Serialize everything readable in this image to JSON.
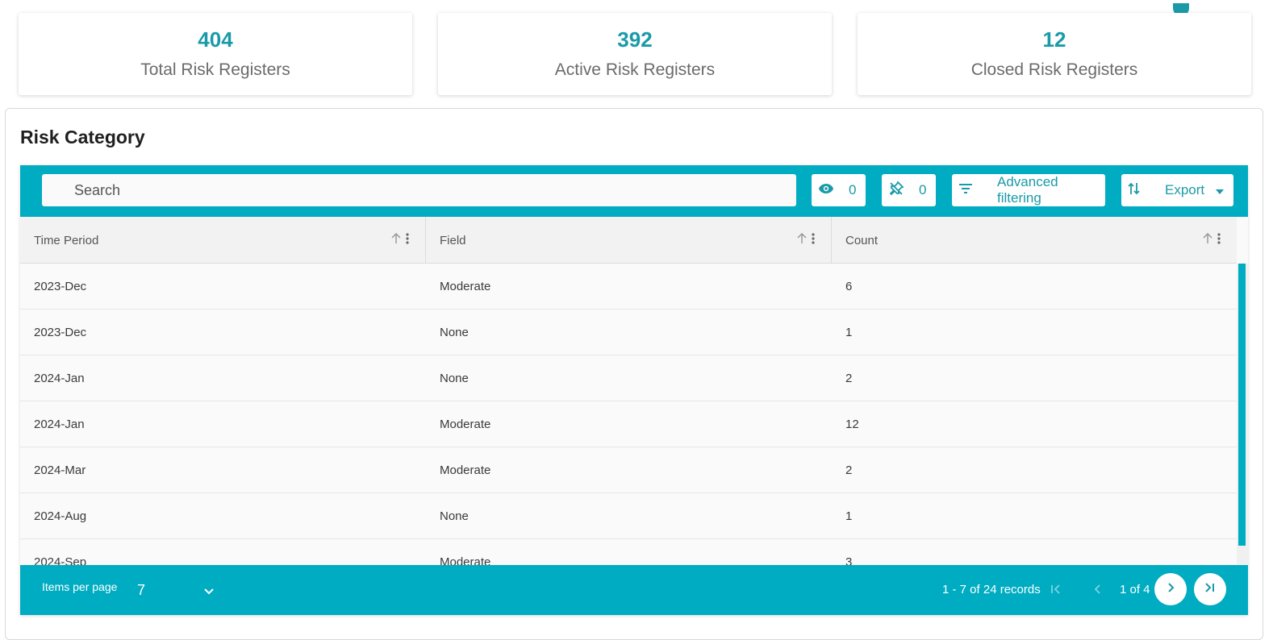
{
  "stats": [
    {
      "value": "404",
      "label": "Total Risk Registers"
    },
    {
      "value": "392",
      "label": "Active Risk Registers"
    },
    {
      "value": "12",
      "label": "Closed Risk Registers"
    }
  ],
  "panel": {
    "title": "Risk Category"
  },
  "toolbar": {
    "search_placeholder": "Search",
    "hidden_count": "0",
    "pinned_count": "0",
    "filter_label": "Advanced filtering",
    "export_label": "Export"
  },
  "table": {
    "columns": [
      "Time Period",
      "Field",
      "Count"
    ],
    "rows": [
      [
        "2023-Dec",
        "Moderate",
        "6"
      ],
      [
        "2023-Dec",
        "None",
        "1"
      ],
      [
        "2024-Jan",
        "None",
        "2"
      ],
      [
        "2024-Jan",
        "Moderate",
        "12"
      ],
      [
        "2024-Mar",
        "Moderate",
        "2"
      ],
      [
        "2024-Aug",
        "None",
        "1"
      ],
      [
        "2024-Sep",
        "Moderate",
        "3"
      ]
    ]
  },
  "pager": {
    "items_per_page_label": "Items per page",
    "items_per_page_value": "7",
    "range_text": "1 - 7 of 24 records",
    "page_text": "1 of 4"
  },
  "colors": {
    "accent": "#00acc1",
    "stat_value": "#1a9aa8"
  },
  "icons": [
    "eye-icon",
    "unpin-icon",
    "filter-icon",
    "sort-swap-icon",
    "caret-down-icon",
    "sort-up-icon",
    "more-vertical-icon",
    "chevron-down-icon",
    "first-page-icon",
    "prev-page-icon",
    "next-page-icon",
    "last-page-icon"
  ]
}
